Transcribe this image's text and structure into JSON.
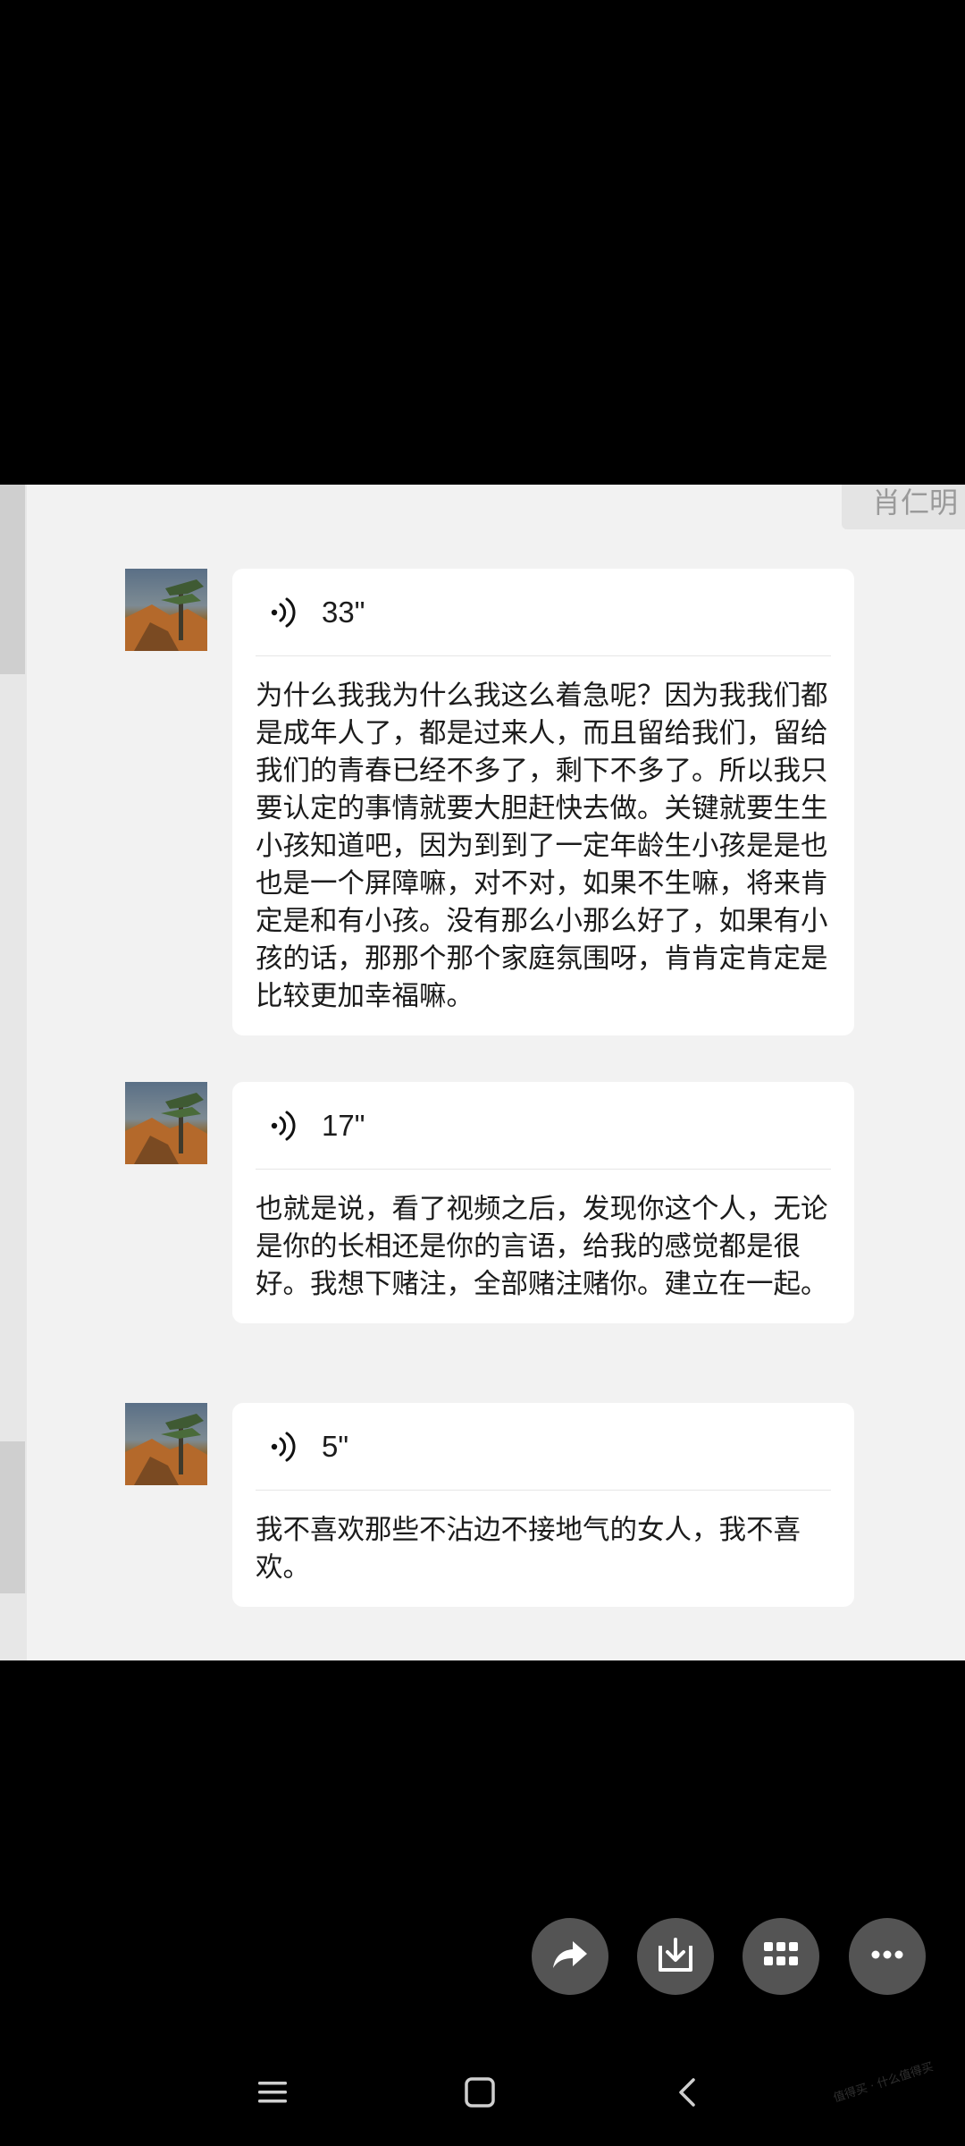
{
  "header": {
    "name_tag": "肖仁明"
  },
  "messages": [
    {
      "duration": "33\"",
      "transcript": "为什么我我为什么我这么着急呢？因为我我们都是成年人了，都是过来人，而且留给我们，留给我们的青春已经不多了，剩下不多了。所以我只要认定的事情就要大胆赶快去做。关键就要生生小孩知道吧，因为到到了一定年龄生小孩是是也也是一个屏障嘛，对不对，如果不生嘛，将来肯定是和有小孩。没有那么小那么好了，如果有小孩的话，那那个那个家庭氛围呀，肯肯定肯定是比较更加幸福嘛。"
    },
    {
      "duration": "17\"",
      "transcript": "也就是说，看了视频之后，发现你这个人，无论是你的长相还是你的言语，给我的感觉都是很好。我想下赌注，全部赌注赌你。建立在一起。"
    },
    {
      "duration": "5\"",
      "transcript": "我不喜欢那些不沾边不接地气的女人，我不喜欢。"
    }
  ],
  "actions": [
    {
      "icon": "share-icon"
    },
    {
      "icon": "download-icon"
    },
    {
      "icon": "grid-icon"
    },
    {
      "icon": "more-icon"
    }
  ],
  "nav": [
    {
      "icon": "menu-icon"
    },
    {
      "icon": "home-icon"
    },
    {
      "icon": "back-icon"
    }
  ],
  "watermark": "值得买 · 什么值得买",
  "colors": {
    "screen_bg": "#000000",
    "chat_bg": "#f2f2f2",
    "bubble_bg": "#ffffff",
    "action_button": "#545454"
  }
}
